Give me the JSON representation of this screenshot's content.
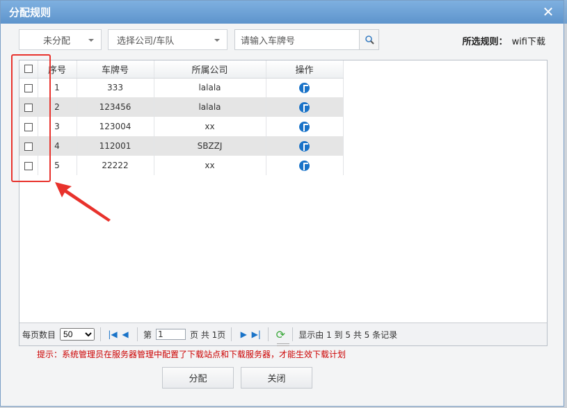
{
  "dialog": {
    "title": "分配规则",
    "close_icon": "close-icon"
  },
  "toolbar": {
    "status_dropdown": "未分配",
    "company_dropdown": "选择公司/车队",
    "search_placeholder": "请输入车牌号",
    "rule_label": "所选规则：",
    "rule_value": "wifi下载"
  },
  "table": {
    "columns": [
      "序号",
      "车牌号",
      "所属公司",
      "操作"
    ],
    "rows": [
      {
        "index": "1",
        "plate": "333",
        "company": "lalala"
      },
      {
        "index": "2",
        "plate": "123456",
        "company": "lalala"
      },
      {
        "index": "3",
        "plate": "123004",
        "company": "xx"
      },
      {
        "index": "4",
        "plate": "112001",
        "company": "SBZZJ"
      },
      {
        "index": "5",
        "plate": "22222",
        "company": "xx"
      }
    ]
  },
  "pager": {
    "page_size_label": "每页数目",
    "page_size": "50",
    "page_prefix": "第",
    "page_value": "1",
    "page_suffix": "页 共 1页",
    "summary": "显示由 1 到 5 共 5 条记录"
  },
  "tip": "提示：系统管理员在服务器管理中配置了下载站点和下载服务器，才能生效下载计划",
  "buttons": {
    "assign": "分配",
    "close": "关闭"
  },
  "colors": {
    "title_bar": "#6fa2d6",
    "accent": "#1a73c8",
    "tip": "#cc0000",
    "annotation": "#e8322c"
  }
}
